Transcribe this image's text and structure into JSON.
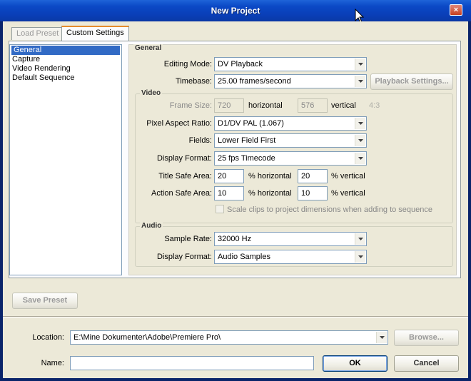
{
  "window": {
    "title": "New Project",
    "close_glyph": "×"
  },
  "tabs": [
    {
      "label": "Load Preset",
      "active": false
    },
    {
      "label": "Custom Settings",
      "active": true
    }
  ],
  "sidebar": {
    "items": [
      {
        "label": "General",
        "selected": true
      },
      {
        "label": "Capture",
        "selected": false
      },
      {
        "label": "Video Rendering",
        "selected": false
      },
      {
        "label": "Default Sequence",
        "selected": false
      }
    ]
  },
  "general": {
    "group_label": "General",
    "editing_mode": {
      "label": "Editing Mode:",
      "value": "DV Playback"
    },
    "timebase": {
      "label": "Timebase:",
      "value": "25.00 frames/second"
    },
    "playback_settings_label": "Playback Settings..."
  },
  "video": {
    "group_label": "Video",
    "frame_size": {
      "label": "Frame Size:",
      "horizontal": "720",
      "horizontal_label": "horizontal",
      "vertical": "576",
      "vertical_label": "vertical",
      "ratio": "4:3"
    },
    "pixel_aspect_ratio": {
      "label": "Pixel Aspect Ratio:",
      "value": "D1/DV PAL (1.067)"
    },
    "fields": {
      "label": "Fields:",
      "value": "Lower Field First"
    },
    "display_format": {
      "label": "Display Format:",
      "value": "25 fps Timecode"
    },
    "title_safe": {
      "label": "Title Safe Area:",
      "horizontal": "20",
      "horizontal_label": "% horizontal",
      "vertical": "20",
      "vertical_label": "% vertical"
    },
    "action_safe": {
      "label": "Action Safe Area:",
      "horizontal": "10",
      "horizontal_label": "% horizontal",
      "vertical": "10",
      "vertical_label": "% vertical"
    },
    "scale_clips_label": "Scale clips to project dimensions when adding to sequence"
  },
  "audio": {
    "group_label": "Audio",
    "sample_rate": {
      "label": "Sample Rate:",
      "value": "32000 Hz"
    },
    "display_format": {
      "label": "Display Format:",
      "value": "Audio Samples"
    }
  },
  "footer": {
    "save_preset_label": "Save Preset",
    "location_label": "Location:",
    "location_value": "E:\\Mine Dokumenter\\Adobe\\Premiere Pro\\",
    "browse_label": "Browse...",
    "name_label": "Name:",
    "name_value": "",
    "ok_label": "OK",
    "cancel_label": "Cancel"
  }
}
